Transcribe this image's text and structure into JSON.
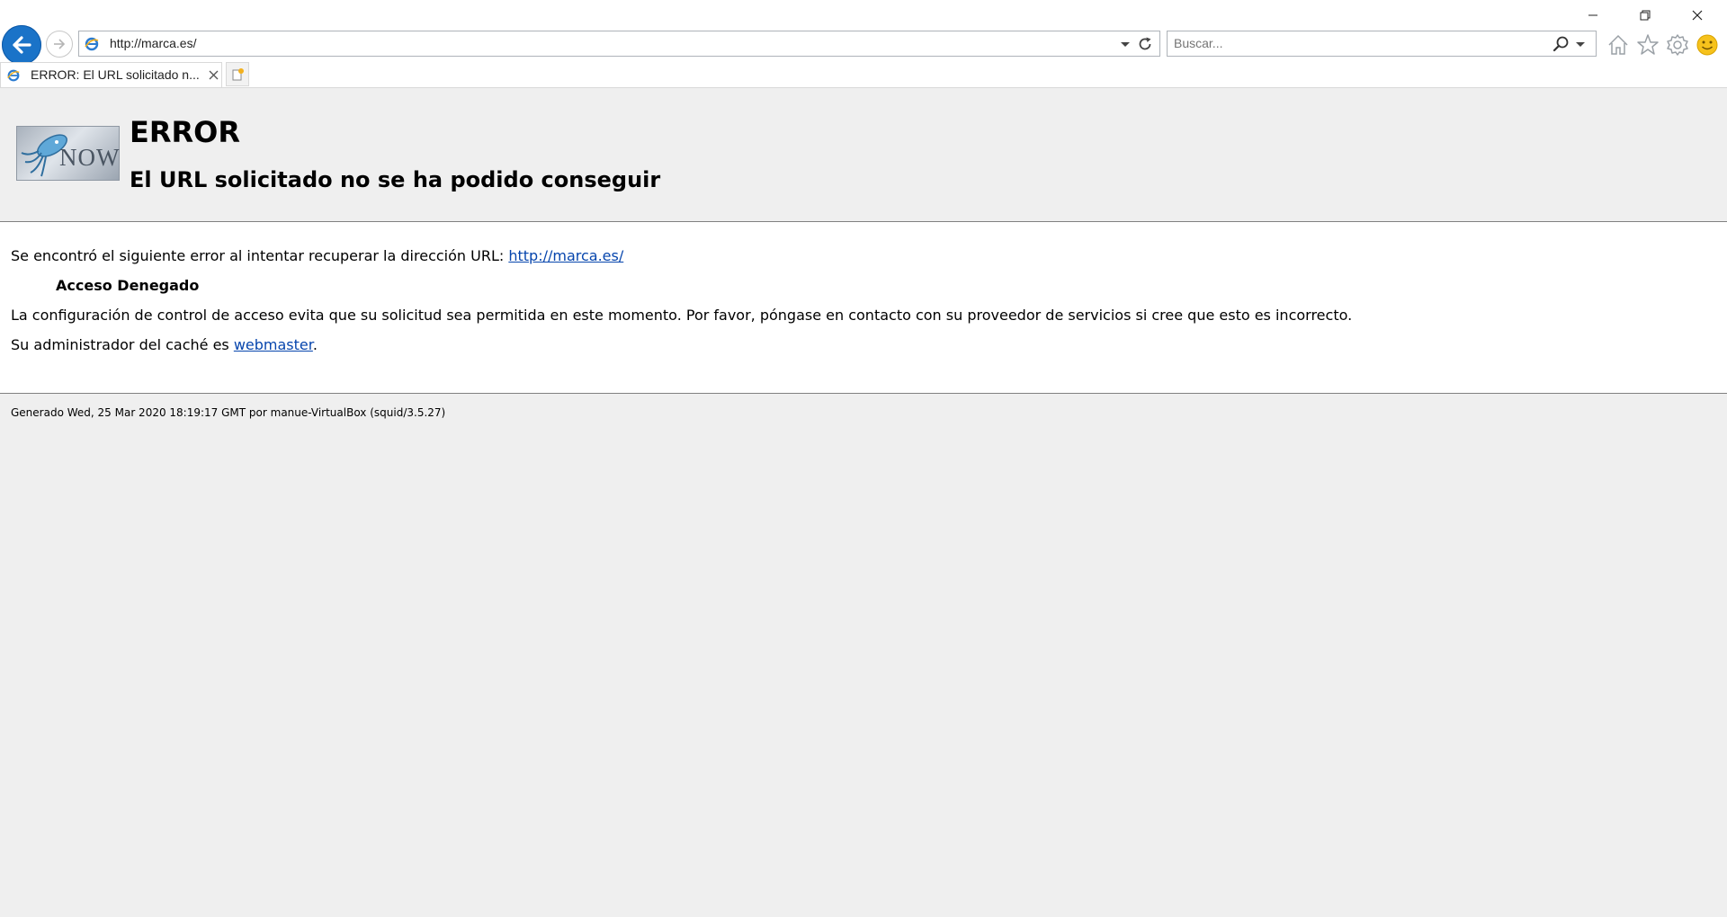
{
  "browser": {
    "address_url": "http://marca.es/",
    "search_placeholder": "Buscar...",
    "tab_title": "ERROR: El URL solicitado n...",
    "accent_color": "#1a73c8"
  },
  "page": {
    "logo_text": "NOW",
    "error_title": "ERROR",
    "error_subtitle": "El URL solicitado no se ha podido conseguir",
    "intro_text": "Se encontró el siguiente error al intentar recuperar la dirección URL: ",
    "intro_link": "http://marca.es/",
    "denied_title": "Acceso Denegado",
    "config_text": "La configuración de control de acceso evita que su solicitud sea permitida en este momento. Por favor, póngase en contacto con su proveedor de servicios si cree que esto es incorrecto.",
    "admin_text": "Su administrador del caché es ",
    "admin_link": "webmaster",
    "admin_suffix": ".",
    "footer": "Generado Wed, 25 Mar 2020 18:19:17 GMT por manue-VirtualBox (squid/3.5.27)",
    "link_color": "#0645ad"
  },
  "icons": {
    "minimize": "minimize-icon",
    "restore": "restore-icon",
    "close": "close-icon",
    "back": "back-arrow-icon",
    "forward": "forward-arrow-icon",
    "refresh": "refresh-icon",
    "search": "search-icon",
    "home": "home-icon",
    "favorites": "star-icon",
    "tools": "gear-icon",
    "feedback": "smiley-icon",
    "new_tab": "new-tab-icon"
  }
}
